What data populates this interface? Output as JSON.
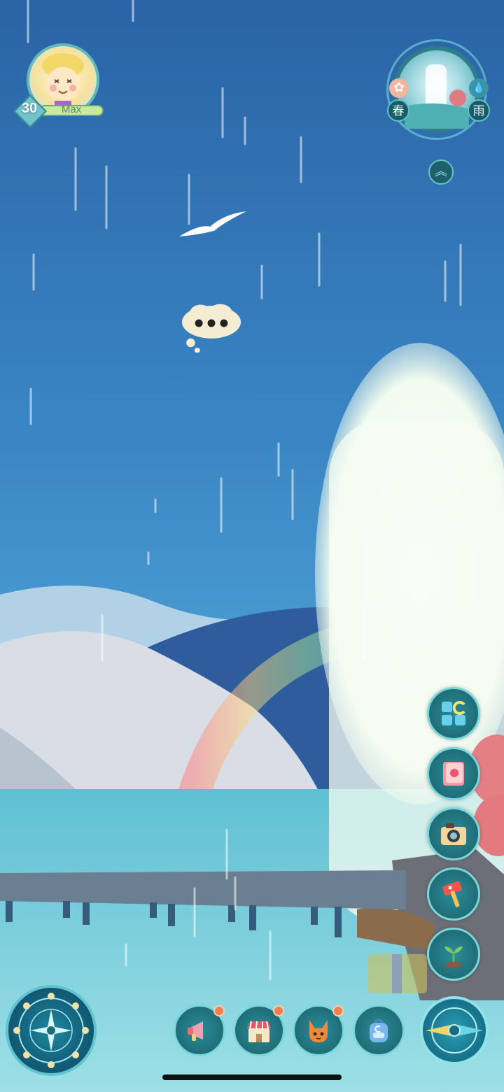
{
  "player": {
    "level": "30",
    "xp_label": "Max"
  },
  "weather": {
    "season": "春",
    "condition": "雨"
  },
  "colors": {
    "sky_top": "#2a63a6",
    "sky_mid": "#3d8dc8",
    "water": "#6cc7d8",
    "ui_teal": "#1f6d78",
    "ui_border": "#7ad7d9",
    "badge_dot": "#ef7f55"
  },
  "icons": {
    "side": [
      "layout-c-icon",
      "flower-book-icon",
      "camera-icon",
      "hammer-icon",
      "sprout-icon"
    ],
    "bottom": [
      "megaphone-icon",
      "shop-icon",
      "fox-icon",
      "backpack-icon"
    ],
    "map": "compass-rose-icon",
    "navigate": "compass-needle-icon"
  }
}
